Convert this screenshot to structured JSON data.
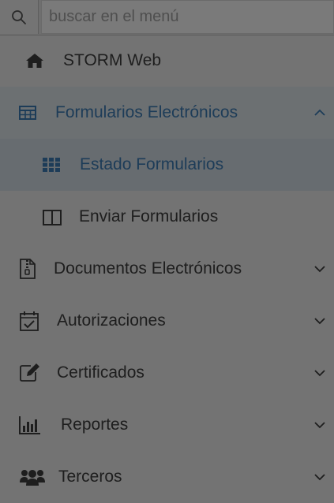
{
  "search": {
    "placeholder": "buscar en el menú",
    "icon": "search-icon"
  },
  "menu": {
    "home": {
      "label": "STORM Web",
      "icon": "home-icon"
    },
    "forms": {
      "label": "Formularios Electrónicos",
      "icon": "table-icon",
      "expanded": true,
      "children": [
        {
          "label": "Estado Formularios",
          "icon": "grid-icon",
          "active": true
        },
        {
          "label": "Enviar Formularios",
          "icon": "columns-icon",
          "active": false
        }
      ]
    },
    "items": [
      {
        "label": "Documentos Electrónicos",
        "icon": "zip-file-icon"
      },
      {
        "label": "Autorizaciones",
        "icon": "calendar-check-icon"
      },
      {
        "label": "Certificados",
        "icon": "edit-icon"
      },
      {
        "label": "Reportes",
        "icon": "bar-chart-icon"
      },
      {
        "label": "Terceros",
        "icon": "users-icon"
      }
    ]
  },
  "colors": {
    "background": "#737373",
    "accent": "#1d3c58",
    "text": "#1e1e1e"
  }
}
